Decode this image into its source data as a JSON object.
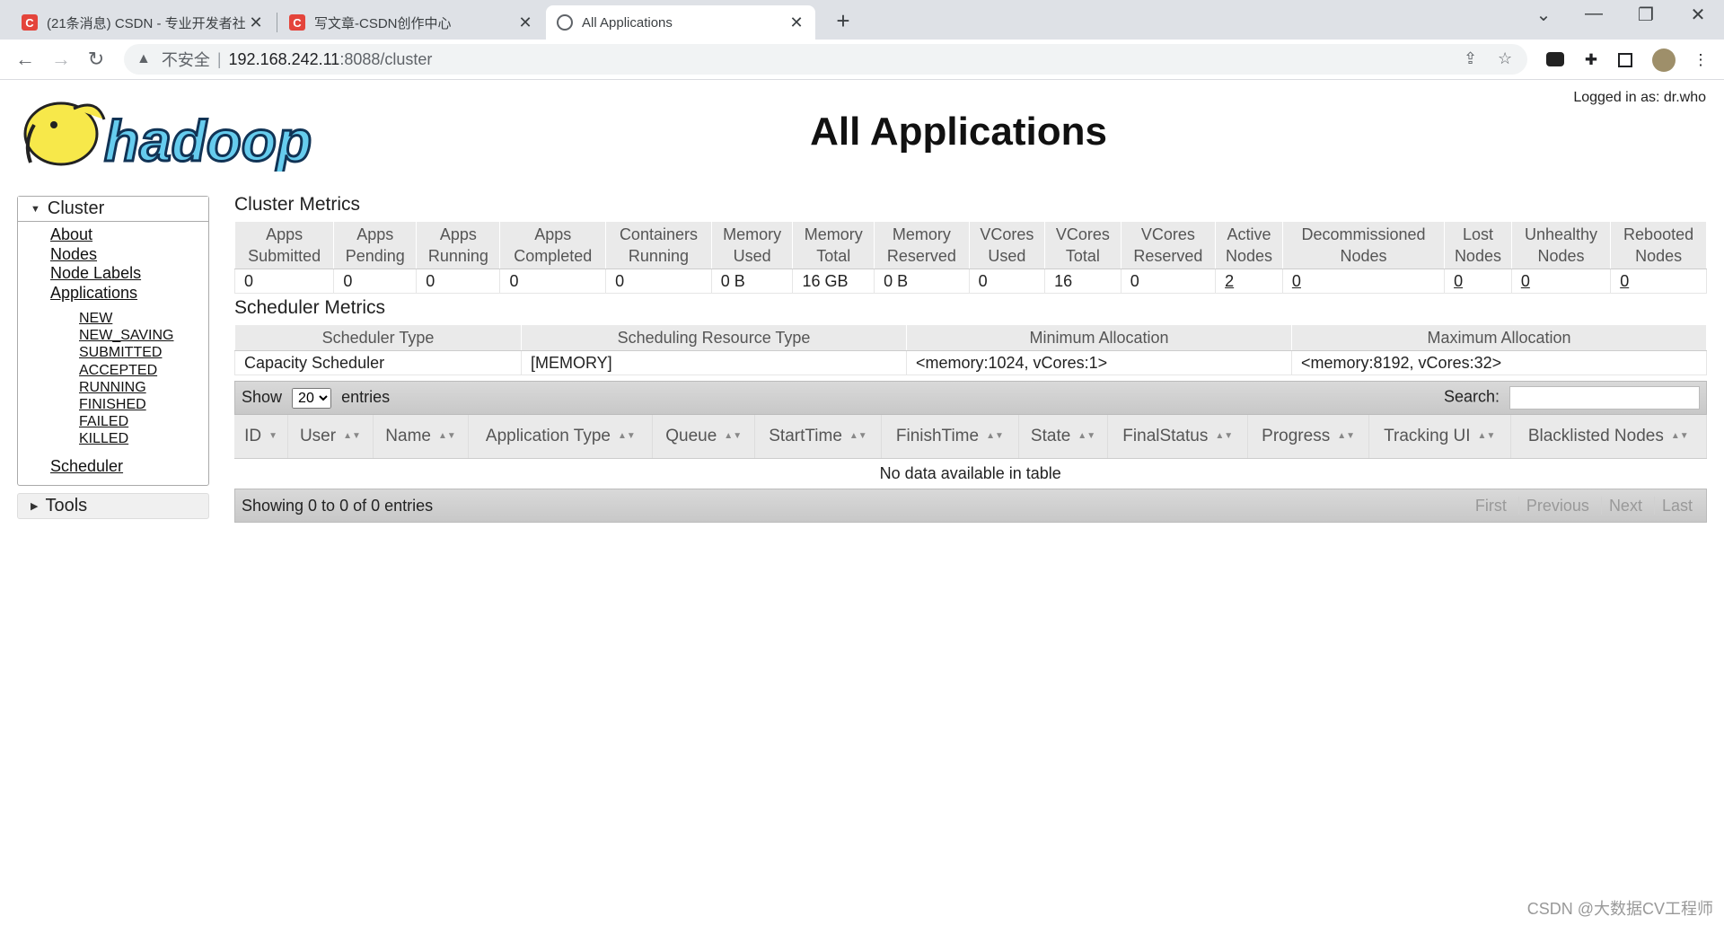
{
  "browser": {
    "tabs": [
      {
        "title": "(21条消息) CSDN - 专业开发者社",
        "favicon": "C"
      },
      {
        "title": "写文章-CSDN创作中心",
        "favicon": "C"
      },
      {
        "title": "All Applications",
        "favicon": "globe-icon"
      }
    ],
    "address": {
      "insecure_label": "不安全",
      "host": "192.168.242.11",
      "path": ":8088/cluster"
    }
  },
  "header": {
    "logo_text": "hadoop",
    "logged_in": "Logged in as: dr.who",
    "title": "All Applications"
  },
  "sidebar": {
    "cluster_label": "Cluster",
    "links": [
      "About",
      "Nodes",
      "Node Labels",
      "Applications"
    ],
    "app_states": [
      "NEW",
      "NEW_SAVING",
      "SUBMITTED",
      "ACCEPTED",
      "RUNNING",
      "FINISHED",
      "FAILED",
      "KILLED"
    ],
    "scheduler": "Scheduler",
    "tools_label": "Tools"
  },
  "cluster_metrics": {
    "title": "Cluster Metrics",
    "headers": [
      [
        "Apps",
        "Submitted"
      ],
      [
        "Apps",
        "Pending"
      ],
      [
        "Apps",
        "Running"
      ],
      [
        "Apps",
        "Completed"
      ],
      [
        "Containers",
        "Running"
      ],
      [
        "Memory",
        "Used"
      ],
      [
        "Memory",
        "Total"
      ],
      [
        "Memory",
        "Reserved"
      ],
      [
        "VCores",
        "Used"
      ],
      [
        "VCores",
        "Total"
      ],
      [
        "VCores",
        "Reserved"
      ],
      [
        "Active",
        "Nodes"
      ],
      [
        "Decommissioned",
        "Nodes"
      ],
      [
        "Lost",
        "Nodes"
      ],
      [
        "Unhealthy",
        "Nodes"
      ],
      [
        "Rebooted",
        "Nodes"
      ]
    ],
    "values": [
      "0",
      "0",
      "0",
      "0",
      "0",
      "0 B",
      "16 GB",
      "0 B",
      "0",
      "16",
      "0",
      "2",
      "0",
      "0",
      "0",
      "0"
    ]
  },
  "scheduler_metrics": {
    "title": "Scheduler Metrics",
    "headers": [
      "Scheduler Type",
      "Scheduling Resource Type",
      "Minimum Allocation",
      "Maximum Allocation"
    ],
    "values": [
      "Capacity Scheduler",
      "[MEMORY]",
      "<memory:1024, vCores:1>",
      "<memory:8192, vCores:32>"
    ]
  },
  "apps_table": {
    "show_label": "Show",
    "entries_value": "20",
    "entries_label": "entries",
    "search_label": "Search:",
    "headers": [
      "ID",
      "User",
      "Name",
      "Application Type",
      "Queue",
      "StartTime",
      "FinishTime",
      "State",
      "FinalStatus",
      "Progress",
      "Tracking UI",
      "Blacklisted Nodes"
    ],
    "empty_text": "No data available in table",
    "info_text": "Showing 0 to 0 of 0 entries",
    "pager": [
      "First",
      "Previous",
      "Next",
      "Last"
    ]
  },
  "watermark": "CSDN @大数据CV工程师"
}
